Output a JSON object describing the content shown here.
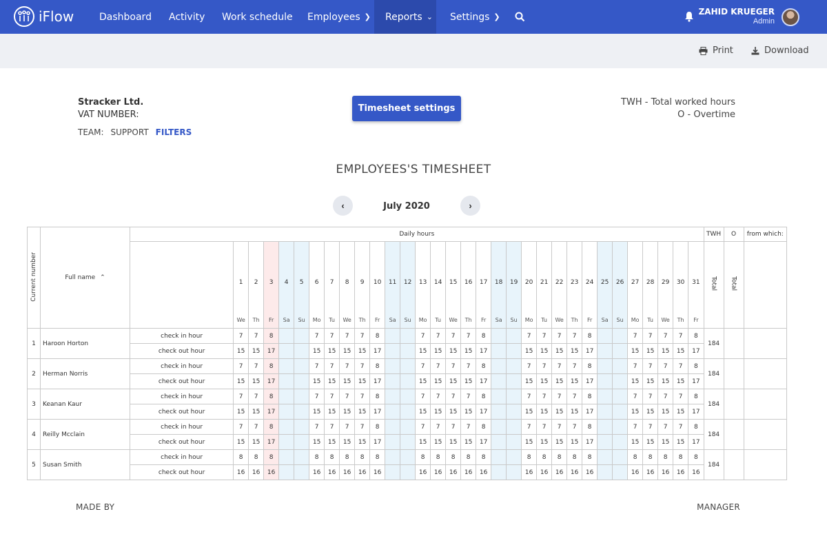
{
  "app": {
    "logo_text": "iFlow"
  },
  "nav": {
    "dashboard": "Dashboard",
    "activity": "Activity",
    "work_schedule": "Work schedule",
    "employees": "Employees",
    "reports": "Reports",
    "settings": "Settings"
  },
  "user": {
    "name": "ZAHID KRUEGER",
    "role": "Admin"
  },
  "toolbar": {
    "print": "Print",
    "download": "Download"
  },
  "company": {
    "name": "Stracker Ltd.",
    "vat_label": "VAT NUMBER:",
    "team_label": "TEAM:",
    "team_value": "SUPPORT",
    "filters": "FILTERS"
  },
  "settings_button": "Timesheet settings",
  "legend": {
    "twh": "TWH - Total worked hours",
    "overtime": "O - Overtime"
  },
  "sheet_title": "EMPLOYEES'S TIMESHEET",
  "month": "July 2020",
  "table": {
    "current_number": "Current number",
    "full_name": "Full name",
    "daily_hours": "Daily hours",
    "twh": "TWH",
    "o": "O",
    "from_which": "from which:",
    "total": "Total",
    "check_in": "check in hour",
    "check_out": "check out hour",
    "days": [
      {
        "n": "1",
        "d": "We",
        "t": ""
      },
      {
        "n": "2",
        "d": "Th",
        "t": ""
      },
      {
        "n": "3",
        "d": "Fr",
        "t": "holiday"
      },
      {
        "n": "4",
        "d": "Sa",
        "t": "weekend"
      },
      {
        "n": "5",
        "d": "Su",
        "t": "weekend"
      },
      {
        "n": "6",
        "d": "Mo",
        "t": ""
      },
      {
        "n": "7",
        "d": "Tu",
        "t": ""
      },
      {
        "n": "8",
        "d": "We",
        "t": ""
      },
      {
        "n": "9",
        "d": "Th",
        "t": ""
      },
      {
        "n": "10",
        "d": "Fr",
        "t": ""
      },
      {
        "n": "11",
        "d": "Sa",
        "t": "weekend"
      },
      {
        "n": "12",
        "d": "Su",
        "t": "weekend"
      },
      {
        "n": "13",
        "d": "Mo",
        "t": ""
      },
      {
        "n": "14",
        "d": "Tu",
        "t": ""
      },
      {
        "n": "15",
        "d": "We",
        "t": ""
      },
      {
        "n": "16",
        "d": "Th",
        "t": ""
      },
      {
        "n": "17",
        "d": "Fr",
        "t": ""
      },
      {
        "n": "18",
        "d": "Sa",
        "t": "weekend"
      },
      {
        "n": "19",
        "d": "Su",
        "t": "weekend"
      },
      {
        "n": "20",
        "d": "Mo",
        "t": ""
      },
      {
        "n": "21",
        "d": "Tu",
        "t": ""
      },
      {
        "n": "22",
        "d": "We",
        "t": ""
      },
      {
        "n": "23",
        "d": "Th",
        "t": ""
      },
      {
        "n": "24",
        "d": "Fr",
        "t": ""
      },
      {
        "n": "25",
        "d": "Sa",
        "t": "weekend"
      },
      {
        "n": "26",
        "d": "Su",
        "t": "weekend"
      },
      {
        "n": "27",
        "d": "Mo",
        "t": ""
      },
      {
        "n": "28",
        "d": "Tu",
        "t": ""
      },
      {
        "n": "29",
        "d": "We",
        "t": ""
      },
      {
        "n": "30",
        "d": "Th",
        "t": ""
      },
      {
        "n": "31",
        "d": "Fr",
        "t": ""
      }
    ],
    "employees": [
      {
        "no": "1",
        "name": "Haroon Horton",
        "in": "7",
        "in_holiday": "8",
        "in_fri": "8",
        "out": "15",
        "out_holiday": "17",
        "out_fri": "17",
        "twh": "184"
      },
      {
        "no": "2",
        "name": "Herman Norris",
        "in": "7",
        "in_holiday": "8",
        "in_fri": "8",
        "out": "15",
        "out_holiday": "17",
        "out_fri": "17",
        "twh": "184"
      },
      {
        "no": "3",
        "name": "Keanan Kaur",
        "in": "7",
        "in_holiday": "8",
        "in_fri": "8",
        "out": "15",
        "out_holiday": "17",
        "out_fri": "17",
        "twh": "184"
      },
      {
        "no": "4",
        "name": "Reilly Mcclain",
        "in": "7",
        "in_holiday": "8",
        "in_fri": "8",
        "out": "15",
        "out_holiday": "17",
        "out_fri": "17",
        "twh": "184"
      },
      {
        "no": "5",
        "name": "Susan Smith",
        "in": "8",
        "in_holiday": "8",
        "in_fri": "8",
        "out": "16",
        "out_holiday": "16",
        "out_fri": "16",
        "twh": "184"
      }
    ]
  },
  "footer": {
    "made_by": "MADE BY",
    "manager": "MANAGER"
  },
  "colors": {
    "primary": "#3558c7",
    "weekend": "#e8f4fb",
    "holiday": "#fdeaea"
  }
}
